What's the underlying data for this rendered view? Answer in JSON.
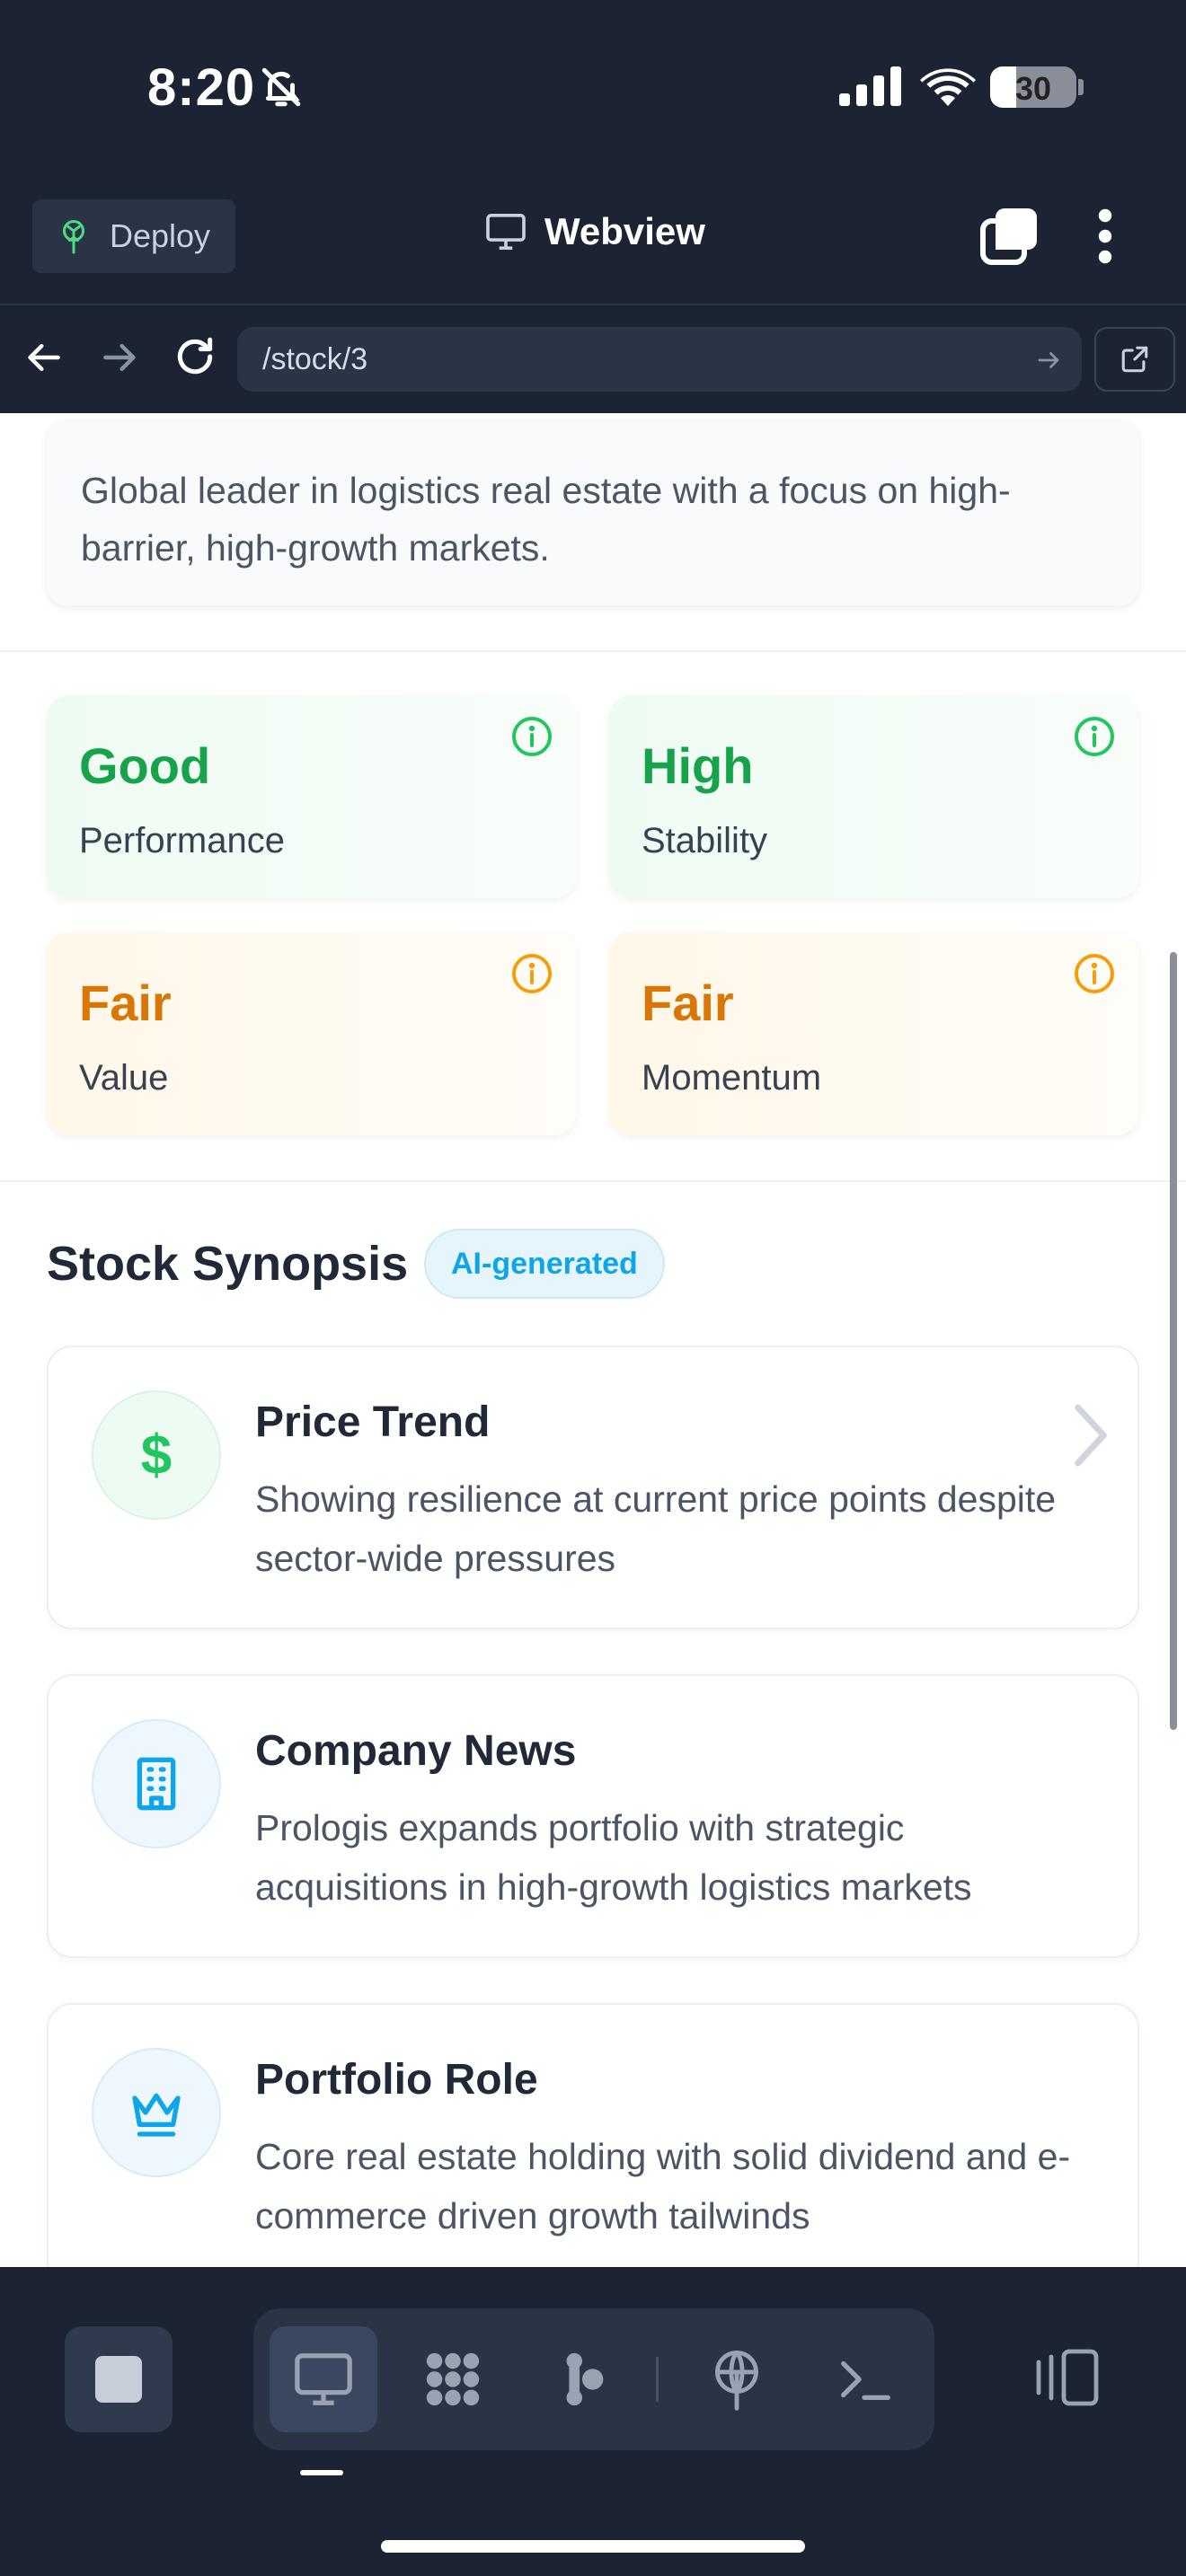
{
  "status_bar": {
    "time": "8:20",
    "battery": "30",
    "battery_level_percent": 30
  },
  "header": {
    "deploy_label": "Deploy",
    "title": "Webview"
  },
  "url_bar": {
    "path": "/stock/3"
  },
  "page": {
    "description": "Global leader in logistics real estate with a focus on high-barrier, high-growth markets.",
    "metrics": [
      {
        "value": "Good",
        "label": "Performance",
        "tone": "good"
      },
      {
        "value": "High",
        "label": "Stability",
        "tone": "good"
      },
      {
        "value": "Fair",
        "label": "Value",
        "tone": "fair"
      },
      {
        "value": "Fair",
        "label": "Momentum",
        "tone": "fair"
      }
    ],
    "synopsis": {
      "title": "Stock Synopsis",
      "badge": "AI-generated",
      "items": [
        {
          "icon": "dollar-icon",
          "title": "Price Trend",
          "text": "Showing resilience at current price points despite sector-wide pressures"
        },
        {
          "icon": "building-icon",
          "title": "Company News",
          "text": "Prologis expands portfolio with strategic acquisitions in high-growth logistics markets"
        },
        {
          "icon": "crown-icon",
          "title": "Portfolio Role",
          "text": "Core real estate holding with solid dividend and e-commerce driven growth tailwinds"
        }
      ]
    }
  },
  "colors": {
    "dark_bg": "#1c2333",
    "good": "#16a34a",
    "fair": "#d97706",
    "accent": "#0ea5e9"
  }
}
